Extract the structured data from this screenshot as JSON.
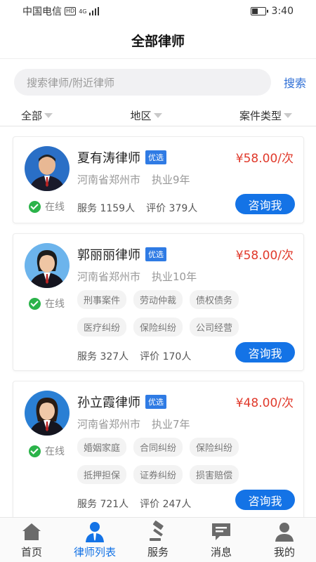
{
  "status": {
    "carrier": "中国电信",
    "hd": "HD",
    "network": "4G",
    "time": "3:40",
    "battery_level": 0.45
  },
  "header": {
    "title": "全部律师"
  },
  "search": {
    "placeholder": "搜索律师/附近律师",
    "button": "搜索"
  },
  "filters": [
    "全部",
    "地区",
    "案件类型"
  ],
  "lawyers": [
    {
      "name": "夏有涛律师",
      "badge": "优选",
      "price": "¥58.00/次",
      "location": "河南省郑州市",
      "experience": "执业9年",
      "online": "在线",
      "served": "服务 1159人",
      "reviews": "评价 379人",
      "button": "咨询我",
      "tags": []
    },
    {
      "name": "郭丽丽律师",
      "badge": "优选",
      "price": "¥58.00/次",
      "location": "河南省郑州市",
      "experience": "执业10年",
      "online": "在线",
      "served": "服务 327人",
      "reviews": "评价 170人",
      "button": "咨询我",
      "tags": [
        "刑事案件",
        "劳动仲裁",
        "债权债务",
        "医疗纠纷",
        "保险纠纷",
        "公司经营"
      ]
    },
    {
      "name": "孙立霞律师",
      "badge": "优选",
      "price": "¥48.00/次",
      "location": "河南省郑州市",
      "experience": "执业7年",
      "online": "在线",
      "served": "服务 721人",
      "reviews": "评价 247人",
      "button": "咨询我",
      "tags": [
        "婚姻家庭",
        "合同纠纷",
        "保险纠纷",
        "抵押担保",
        "证券纠纷",
        "损害赔偿"
      ]
    }
  ],
  "tabs": [
    {
      "label": "首页",
      "icon": "home-icon"
    },
    {
      "label": "律师列表",
      "icon": "lawyer-icon",
      "active": true
    },
    {
      "label": "服务",
      "icon": "gavel-icon"
    },
    {
      "label": "消息",
      "icon": "message-icon"
    },
    {
      "label": "我的",
      "icon": "user-icon"
    }
  ],
  "colors": {
    "accent": "#1473e6",
    "price": "#e0392b",
    "online": "#2bb34a",
    "badge": "#2f7be4"
  }
}
